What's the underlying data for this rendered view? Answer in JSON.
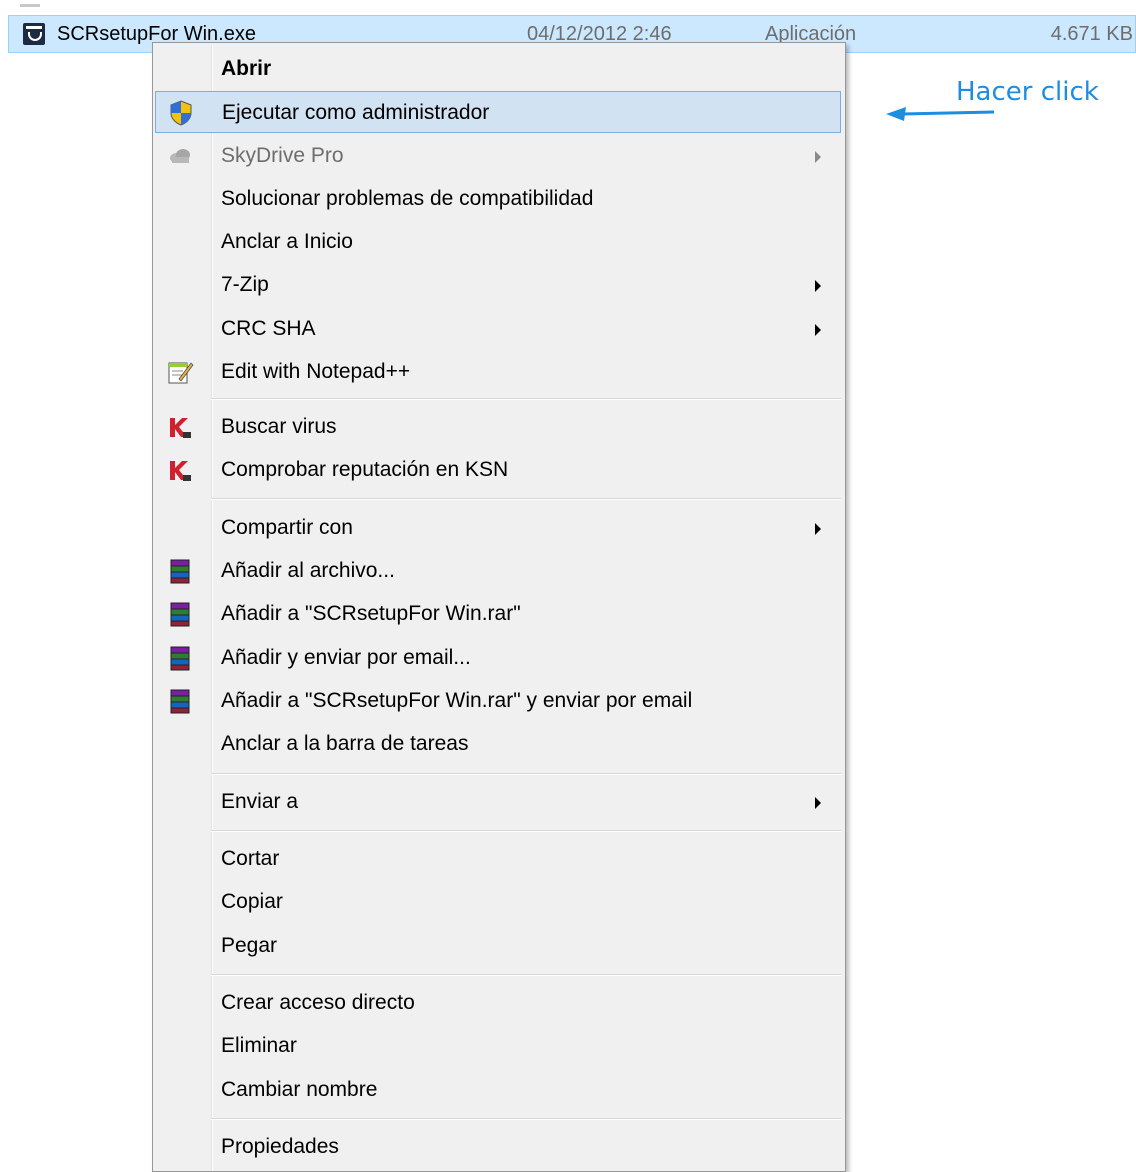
{
  "file": {
    "name": "SCRsetupFor Win.exe",
    "date": "04/12/2012 2:46",
    "type": "Aplicación",
    "size": "4.671 KB",
    "icon": "setup-app-icon"
  },
  "annotation": {
    "text": "Hacer click",
    "color": "#1d8de2"
  },
  "menu": {
    "items": [
      {
        "label": "Abrir",
        "bold": true
      },
      {
        "label": "Ejecutar como administrador",
        "icon": "uac-shield-icon",
        "highlighted": true
      },
      {
        "label": "SkyDrive Pro",
        "icon": "cloud-icon",
        "disabled": true,
        "submenu": true
      },
      {
        "label": "Solucionar problemas de compatibilidad"
      },
      {
        "label": "Anclar a Inicio"
      },
      {
        "label": "7-Zip",
        "submenu": true
      },
      {
        "label": "CRC SHA",
        "submenu": true
      },
      {
        "label": "Edit with Notepad++",
        "icon": "notepad-icon"
      },
      {
        "label": "Buscar virus",
        "icon": "kaspersky-icon"
      },
      {
        "label": "Comprobar reputación en KSN",
        "icon": "kaspersky-icon"
      },
      {
        "label": "Compartir con",
        "submenu": true
      },
      {
        "label": "Añadir al archivo...",
        "icon": "winrar-icon"
      },
      {
        "label": "Añadir a \"SCRsetupFor Win.rar\"",
        "icon": "winrar-icon"
      },
      {
        "label": "Añadir y enviar por email...",
        "icon": "winrar-icon"
      },
      {
        "label": "Añadir a \"SCRsetupFor Win.rar\" y enviar por email",
        "icon": "winrar-icon"
      },
      {
        "label": "Anclar a la barra de tareas"
      },
      {
        "label": "Enviar a",
        "submenu": true
      },
      {
        "label": "Cortar"
      },
      {
        "label": "Copiar"
      },
      {
        "label": "Pegar"
      },
      {
        "label": "Crear acceso directo"
      },
      {
        "label": "Eliminar"
      },
      {
        "label": "Cambiar nombre"
      },
      {
        "label": "Propiedades"
      }
    ]
  }
}
